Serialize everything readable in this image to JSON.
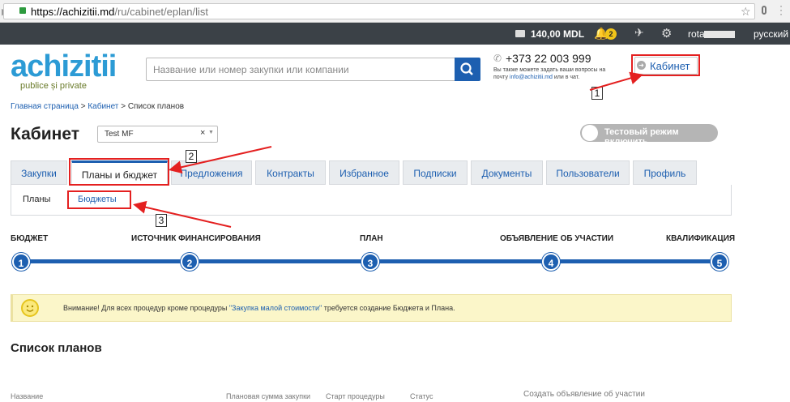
{
  "browser": {
    "secure_icon": "lock-icon",
    "url_host": "https://achizitii.md",
    "url_path": "/ru/cabinet/eplan/list"
  },
  "topnav": {
    "balance": "140,00 MDL",
    "notifications_count": "2",
    "user": "rota",
    "language": "русский"
  },
  "header": {
    "logo_text": "achizitii",
    "logo_sub": "publice și private",
    "search_placeholder": "Название или номер закупки или компании",
    "phone": "+373 22 003 999",
    "phone_note_1": "Вы также можете задать ваши вопросы на",
    "phone_note_2": "почту",
    "phone_note_email": "info@achizitii.md",
    "phone_note_3": "или в чат.",
    "cabinet_label": "Кабинет"
  },
  "annotations": {
    "label_1": "1",
    "label_2": "2",
    "label_3": "3"
  },
  "breadcrumb": {
    "home": "Главная страница",
    "cabinet": "Кабинет",
    "current": "Список планов",
    "sep": ">"
  },
  "page": {
    "title": "Кабинет",
    "company_select": "Test MF",
    "test_mode": "Тестовый режим включить"
  },
  "tabs": [
    "Закупки",
    "Планы и бюджет",
    "Предложения",
    "Контракты",
    "Избранное",
    "Подписки",
    "Документы",
    "Пользователи",
    "Профиль"
  ],
  "subtabs": [
    "Планы",
    "Бюджеты"
  ],
  "steps": [
    {
      "num": "1",
      "label": "БЮДЖЕТ"
    },
    {
      "num": "2",
      "label": "ИСТОЧНИК ФИНАНСИРОВАНИЯ"
    },
    {
      "num": "3",
      "label": "ПЛАН"
    },
    {
      "num": "4",
      "label": "ОБЪЯВЛЕНИЕ ОБ УЧАСТИИ"
    },
    {
      "num": "5",
      "label": "КВАЛИФИКАЦИЯ"
    }
  ],
  "notice": {
    "text_1": "Внимание! Для всех процедур кроме процедуры",
    "link": "\"Закупка малой стоимости\"",
    "text_2": "требуется создание Бюджета и Плана."
  },
  "list": {
    "title": "Список планов",
    "columns": [
      "Название",
      "Плановая сумма закупки",
      "Старт процедуры",
      "Статус",
      "Создать объявление об участии"
    ]
  },
  "colors": {
    "accent": "#1d5fb0",
    "highlight": "#e42020",
    "nav_bg": "#3b4147"
  }
}
